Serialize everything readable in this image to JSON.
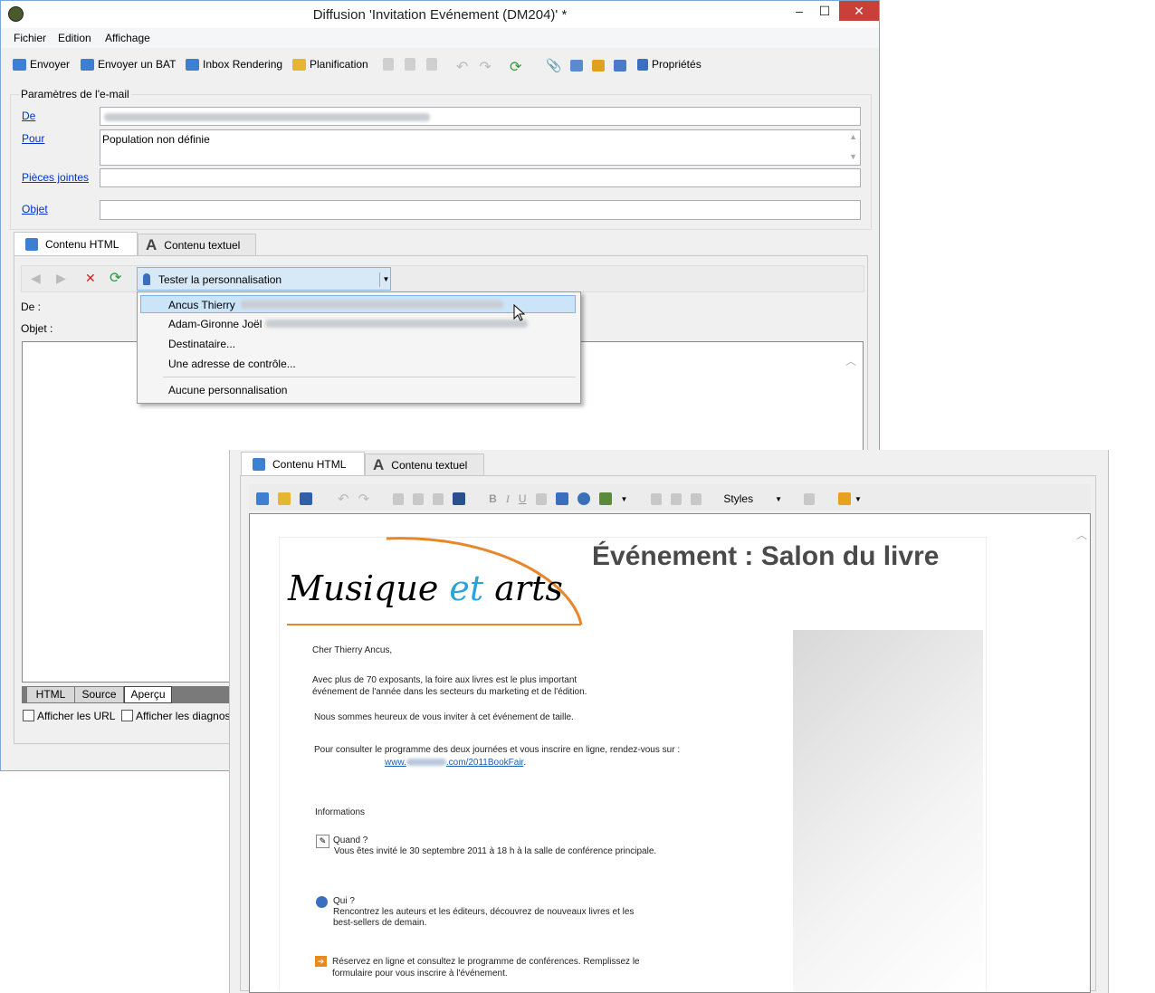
{
  "window_back": {
    "title": "Diffusion 'Invitation Evénement (DM204)' *",
    "controls": {
      "minimize": "–",
      "maximize": "☐",
      "close": "✕"
    },
    "menu": [
      "Fichier",
      "Edition",
      "Affichage"
    ],
    "toolbar": {
      "envoyer": "Envoyer",
      "envoyer_bat": "Envoyer un BAT",
      "inbox_rendering": "Inbox Rendering",
      "planification": "Planification",
      "proprietes": "Propriétés"
    },
    "email_params": {
      "group_label": "Paramètres de l'e-mail",
      "de_label": "De",
      "pour_label": "Pour",
      "pour_value": "Population non définie",
      "pieces_label": "Pièces jointes",
      "objet_label": "Objet"
    },
    "tabs": {
      "html": "Contenu HTML",
      "text": "Contenu textuel"
    },
    "personalization": {
      "combo_label": "Tester la personnalisation",
      "items": [
        {
          "name": "Ancus Thierry"
        },
        {
          "name": "Adam-Gironne Joël"
        },
        {
          "name": "Destinataire..."
        },
        {
          "name": "Une adresse de contrôle..."
        },
        {
          "name": "Aucune personnalisation"
        }
      ]
    },
    "preview_labels": {
      "de": "De :",
      "objet": "Objet :"
    },
    "bottom_tabs": [
      "HTML",
      "Source",
      "Aperçu"
    ],
    "checkboxes": {
      "urls": "Afficher les URL",
      "diag": "Afficher les diagnos"
    }
  },
  "window_front": {
    "tabs": {
      "html": "Contenu HTML",
      "text": "Contenu textuel"
    },
    "toolbar": {
      "bold": "B",
      "italic": "I",
      "underline": "U",
      "styles": "Styles"
    },
    "email": {
      "logo_word1": "Musique",
      "logo_word2": "et",
      "logo_word3": "arts",
      "headline": "Événement : Salon du livre",
      "greeting": "Cher Thierry Ancus,",
      "p1_line1": "Avec plus de 70 exposants, la foire aux livres est le plus important",
      "p1_line2": "événement de l'année dans les secteurs du marketing et de l'édition.",
      "p2": "Nous sommes heureux de vous inviter à cet événement de taille.",
      "p3": "Pour consulter le programme des deux journées et vous inscrire en ligne, rendez-vous sur :",
      "link_prefix": "www.",
      "link_suffix": ".com/2011BookFair",
      "link_end": ".",
      "info_heading": "Informations",
      "quand_title": "Quand ?",
      "quand_text": "Vous êtes invité le 30 septembre 2011 à 18 h à la salle de conférence principale.",
      "qui_title": "Qui ?",
      "qui_line1": "Rencontrez les auteurs et les éditeurs, découvrez de nouveaux livres et les",
      "qui_line2": "best-sellers de demain.",
      "reserve_line1": "Réservez en ligne et consultez le programme de conférences. Remplissez le",
      "reserve_line2": "formulaire pour vous inscrire à l'événement."
    }
  },
  "colors": {
    "title_blue_border": "#7aa7d6",
    "close_red": "#c7413a",
    "link_blue": "#0033cc",
    "logo_orange": "#e8862a",
    "logo_blue": "#2aa3d8",
    "headline_gray": "#4a4a4a",
    "selected_row": "#cce4f7"
  }
}
